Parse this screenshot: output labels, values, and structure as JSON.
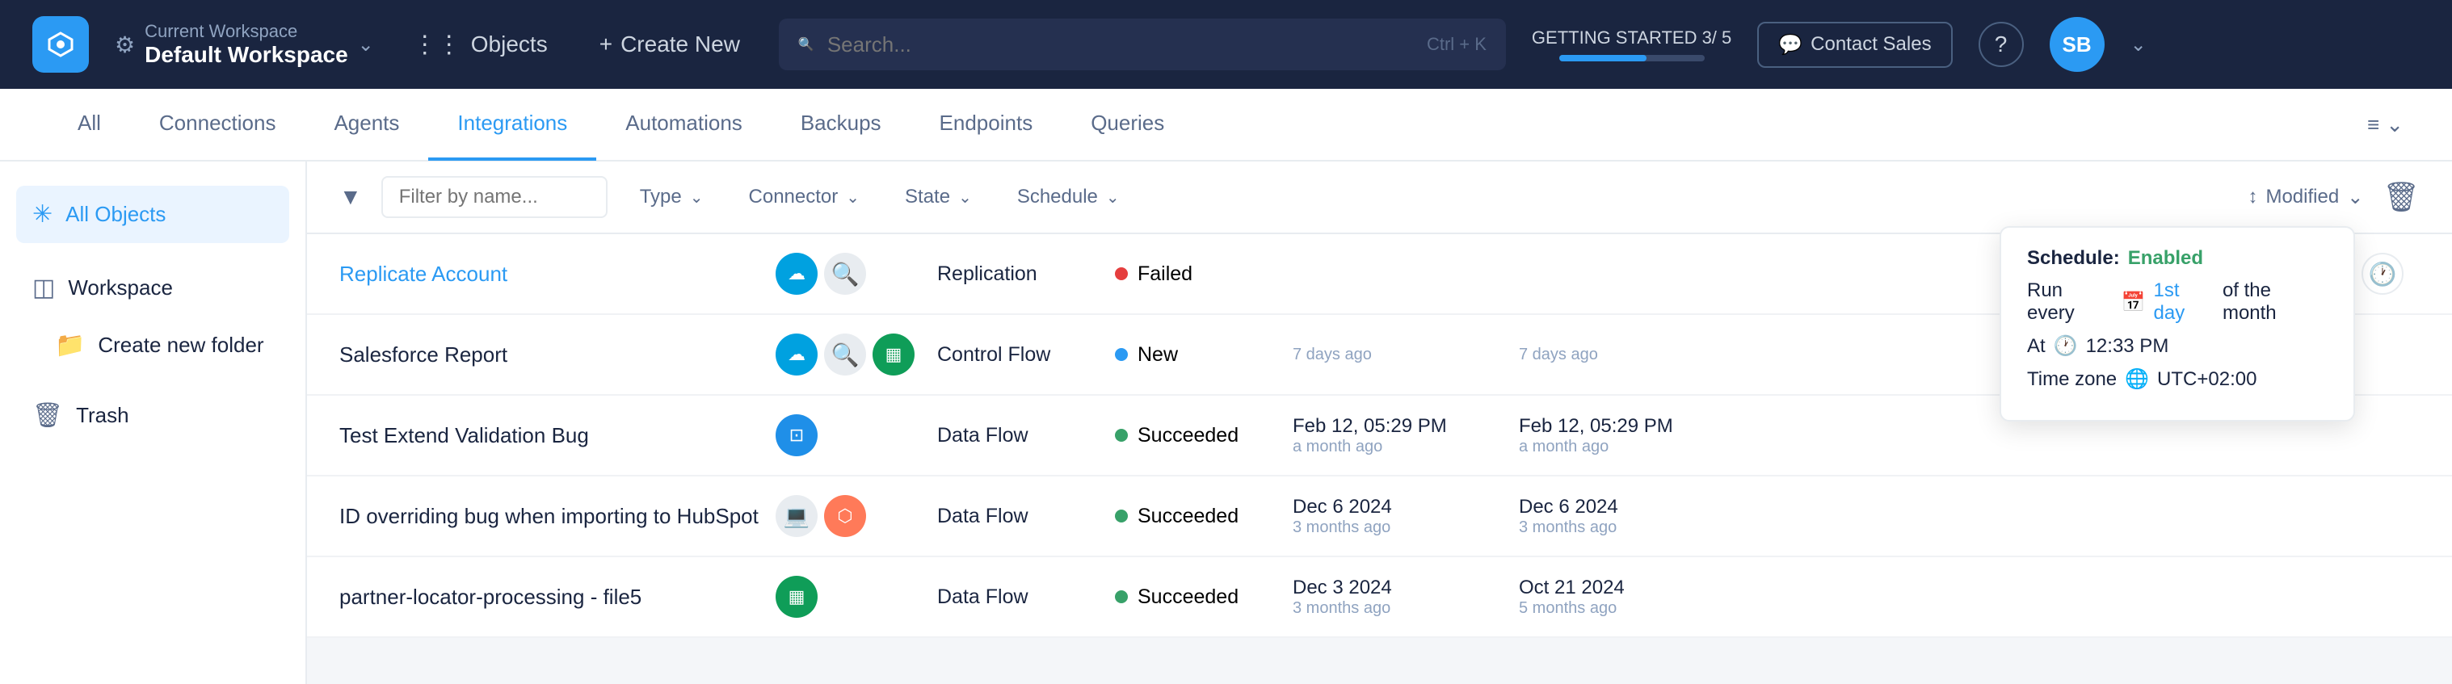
{
  "app": {
    "logo_alt": "Workato",
    "workspace_label": "Current Workspace",
    "workspace_name": "Default Workspace"
  },
  "topnav": {
    "objects_label": "Objects",
    "create_new_label": "Create New",
    "search_placeholder": "Search...",
    "search_shortcut": "Ctrl + K",
    "getting_started_label": "GETTING STARTED 3/ 5",
    "progress_pct": 60,
    "contact_sales_label": "Contact Sales",
    "help_label": "?",
    "avatar_initials": "SB"
  },
  "subnav": {
    "tabs": [
      {
        "id": "all",
        "label": "All"
      },
      {
        "id": "connections",
        "label": "Connections"
      },
      {
        "id": "agents",
        "label": "Agents"
      },
      {
        "id": "integrations",
        "label": "Integrations"
      },
      {
        "id": "automations",
        "label": "Automations"
      },
      {
        "id": "backups",
        "label": "Backups"
      },
      {
        "id": "endpoints",
        "label": "Endpoints"
      },
      {
        "id": "queries",
        "label": "Queries"
      }
    ],
    "active_tab": "integrations"
  },
  "sidebar": {
    "all_objects_label": "All Objects",
    "workspace_label": "Workspace",
    "create_folder_label": "Create new folder",
    "trash_label": "Trash"
  },
  "filterbar": {
    "filter_placeholder": "Filter by name...",
    "type_label": "Type",
    "connector_label": "Connector",
    "state_label": "State",
    "schedule_label": "Schedule",
    "sort_label": "Modified"
  },
  "table": {
    "rows": [
      {
        "name": "Replicate Account",
        "is_link": true,
        "type": "Replication",
        "state": "Failed",
        "state_color": "#e53e3e",
        "connectors": [
          "salesforce",
          "search"
        ],
        "created_date": "",
        "created_rel": "",
        "modified_date": "",
        "modified_rel": "",
        "has_tooltip": true,
        "has_clock": true
      },
      {
        "name": "Salesforce Report",
        "is_link": false,
        "type": "Control Flow",
        "state": "New",
        "state_color": "#2b9af3",
        "connectors": [
          "salesforce",
          "search2",
          "sheets"
        ],
        "created_date": "",
        "created_rel": "7 days ago",
        "modified_date": "",
        "modified_rel": "7 days ago",
        "has_tooltip": false,
        "has_clock": false
      },
      {
        "name": "Test Extend Validation Bug",
        "is_link": false,
        "type": "Data Flow",
        "state": "Succeeded",
        "state_color": "#38a169",
        "connectors": [
          "intercom"
        ],
        "created_date": "Feb 12, 05:29 PM",
        "created_rel": "a month ago",
        "modified_date": "Feb 12, 05:29 PM",
        "modified_rel": "a month ago",
        "has_tooltip": false,
        "has_clock": false
      },
      {
        "name": "ID overriding bug when importing to HubSpot",
        "is_link": false,
        "type": "Data Flow",
        "state": "Succeeded",
        "state_color": "#38a169",
        "connectors": [
          "laptop",
          "hubspot"
        ],
        "created_date": "Dec 6 2024",
        "created_rel": "3 months ago",
        "modified_date": "Dec 6 2024",
        "modified_rel": "3 months ago",
        "has_tooltip": false,
        "has_clock": false
      },
      {
        "name": "partner-locator-processing - file5",
        "is_link": false,
        "type": "Data Flow",
        "state": "Succeeded",
        "state_color": "#38a169",
        "connectors": [
          "sheets2"
        ],
        "created_date": "Dec 3 2024",
        "created_rel": "3 months ago",
        "modified_date": "Oct 21 2024",
        "modified_rel": "5 months ago",
        "has_tooltip": false,
        "has_clock": false
      }
    ],
    "tooltip": {
      "schedule_label": "Schedule:",
      "schedule_value": "Enabled",
      "run_prefix": "Run every",
      "run_day": "1st day",
      "run_suffix": "of the month",
      "time_label": "At",
      "time_value": "12:33 PM",
      "timezone_label": "Time zone",
      "timezone_value": "UTC+02:00"
    }
  }
}
